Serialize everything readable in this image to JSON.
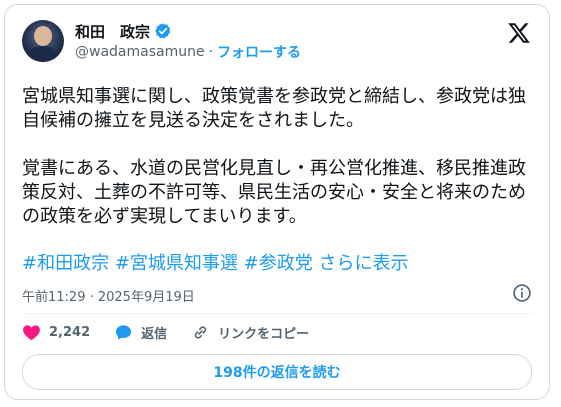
{
  "author": {
    "display_name": "和田　政宗",
    "handle": "@wadamasamune",
    "follow_label": "フォローする",
    "verified": true
  },
  "post": {
    "text": "宮城県知事選に関し、政策覚書を参政党と締結し、参政党は独自候補の擁立を見送る決定をされました。\n\n覚書にある、水道の民営化見直し・再公営化推進、移民推進政策反対、土葬の不許可等、県民生活の安心・安全と将来のための政策を必ず実現してまいります。",
    "hashtags": [
      "#和田政宗",
      "#宮城県知事選",
      "#参政党"
    ],
    "show_more": "さらに表示",
    "timestamp": "午前11:29 · 2025年9月19日"
  },
  "actions": {
    "likes": "2,242",
    "reply_label": "返信",
    "copy_link_label": "リンクをコピー"
  },
  "read_replies_label": "198件の返信を読む",
  "colors": {
    "accent": "#1d9bf0",
    "like": "#f91880",
    "text": "#0f1419",
    "muted": "#536471"
  }
}
